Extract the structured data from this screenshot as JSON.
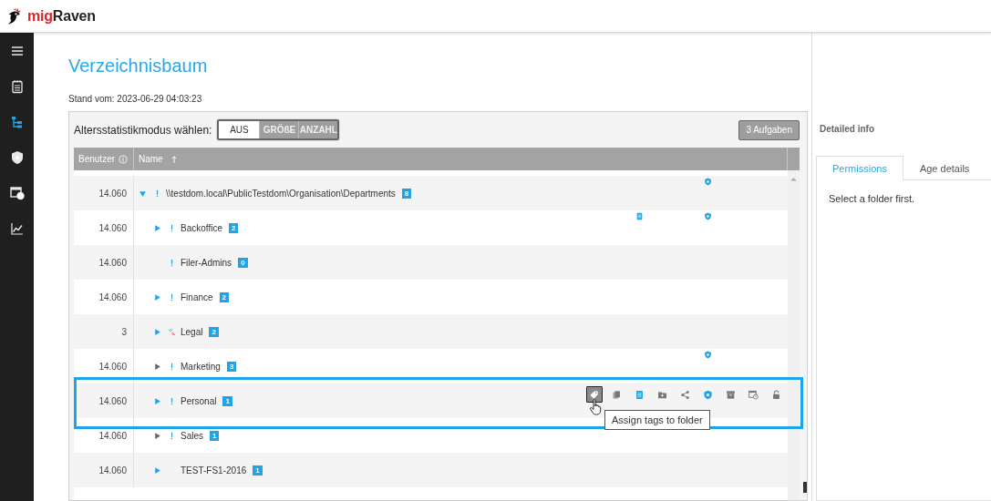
{
  "header": {
    "logo_part_1": "mig",
    "logo_part_2": "Raven"
  },
  "sidebar": {
    "items": [
      {
        "kind": "menu",
        "selected": false
      },
      {
        "kind": "notepad",
        "selected": false
      },
      {
        "kind": "tree",
        "selected": true
      },
      {
        "kind": "shield",
        "selected": false
      },
      {
        "kind": "calendar-clock",
        "selected": false
      },
      {
        "kind": "chart",
        "selected": false
      }
    ]
  },
  "page": {
    "title": "Verzeichnisbaum",
    "timestamp": "Stand vom: 2023-06-29 04:03:23"
  },
  "toolbar": {
    "mode_label": "Altersstatistikmodus wählen:",
    "modes": [
      {
        "label": "AUS",
        "selected": true
      },
      {
        "label": "GRÖßE",
        "selected": false
      },
      {
        "label": "ANZAHL",
        "selected": false
      }
    ],
    "tasks_button": "3 Aufgaben"
  },
  "table": {
    "columns": [
      {
        "label": "Benutzer",
        "kind": "info"
      },
      {
        "label": "Name",
        "kind": "sort-up"
      }
    ],
    "row_actions": [
      {
        "kind": "tag",
        "hovered": true,
        "tooltip": "Assign tags to folder"
      },
      {
        "kind": "copy",
        "hovered": false
      },
      {
        "kind": "doc",
        "hovered": false
      },
      {
        "kind": "folder-add",
        "hovered": false
      },
      {
        "kind": "share",
        "hovered": false
      },
      {
        "kind": "shield",
        "hovered": false
      },
      {
        "kind": "archive",
        "hovered": false
      },
      {
        "kind": "calendar-clock",
        "hovered": false
      },
      {
        "kind": "lock-open",
        "hovered": false
      }
    ],
    "rows": [
      {
        "users": "14.060",
        "name": "\\\\testdom.local\\PublicTestdom\\Organisation\\Departments",
        "count": "8",
        "expandable": true,
        "expanded": true,
        "disabled": false,
        "flag": {
          "kind": "warning"
        },
        "indicators": [
          {
            "kind": "shield"
          }
        ],
        "selected": false,
        "hovered": false,
        "children": [
          {
            "users": "14.060",
            "name": "Backoffice",
            "count": "2",
            "expandable": true,
            "expanded": false,
            "disabled": false,
            "flag": {
              "kind": "warning"
            },
            "indicators": [
              {
                "kind": "doc"
              },
              {
                "kind": "shield"
              }
            ],
            "selected": false,
            "hovered": false
          },
          {
            "users": "14.060",
            "name": "Filer-Admins",
            "count": "0",
            "expandable": false,
            "flag": {
              "kind": "warning"
            },
            "selected": false,
            "hovered": false
          },
          {
            "users": "14.060",
            "name": "Finance",
            "count": "2",
            "expandable": true,
            "expanded": false,
            "disabled": false,
            "flag": {
              "kind": "warning"
            },
            "selected": false,
            "hovered": false
          },
          {
            "users": "3",
            "name": "Legal",
            "count": "2",
            "expandable": true,
            "expanded": false,
            "disabled": false,
            "flag": {
              "kind": "broken"
            },
            "selected": false,
            "hovered": false
          },
          {
            "users": "14.060",
            "name": "Marketing",
            "count": "3",
            "expandable": true,
            "expanded": false,
            "disabled": true,
            "flag": {
              "kind": "warning"
            },
            "indicators": [
              {
                "kind": "shield"
              }
            ],
            "selected": false,
            "hovered": false
          },
          {
            "users": "14.060",
            "name": "Personal",
            "count": "1",
            "expandable": true,
            "expanded": false,
            "disabled": false,
            "flag": {
              "kind": "warning"
            },
            "selected": true,
            "hovered": true
          },
          {
            "users": "14.060",
            "name": "Sales",
            "count": "1",
            "expandable": true,
            "expanded": false,
            "disabled": true,
            "flag": {
              "kind": "warning"
            },
            "selected": false,
            "hovered": false
          },
          {
            "users": "14.060",
            "name": "TEST-FS1-2016",
            "count": "1",
            "expandable": true,
            "expanded": false,
            "disabled": false,
            "selected": false,
            "hovered": false
          }
        ]
      }
    ]
  },
  "details": {
    "title": "Detailed info",
    "tabs": [
      {
        "label": "Permissions",
        "selected": true
      },
      {
        "label": "Age details",
        "selected": false
      }
    ],
    "message": "Select a folder first."
  }
}
